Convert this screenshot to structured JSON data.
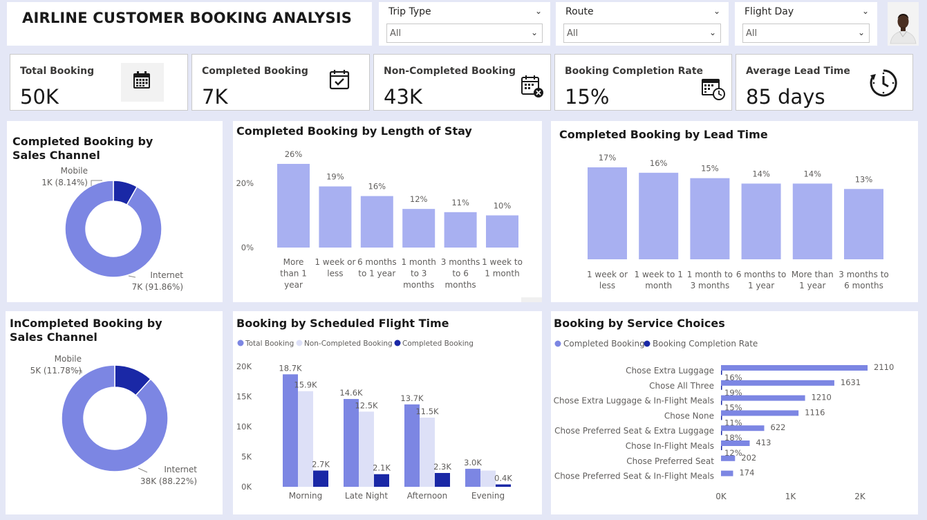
{
  "header": {
    "title": "AIRLINE CUSTOMER BOOKING ANALYSIS"
  },
  "slicers": [
    {
      "label": "Trip Type",
      "value": "All"
    },
    {
      "label": "Route",
      "value": "All"
    },
    {
      "label": "Flight Day",
      "value": "All"
    }
  ],
  "kpis": [
    {
      "label": "Total Booking",
      "value": "50K",
      "icon": "calendar-icon"
    },
    {
      "label": "Completed Booking",
      "value": "7K",
      "icon": "calendar-check-icon"
    },
    {
      "label": "Non-Completed Booking",
      "value": "43K",
      "icon": "calendar-x-icon"
    },
    {
      "label": "Booking Completion Rate",
      "value": "15%",
      "icon": "calendar-clock-icon"
    },
    {
      "label": "Average Lead Time",
      "value": "85 days",
      "icon": "timer-icon"
    }
  ],
  "colors": {
    "primary": "#7c86e3",
    "light": "#a8b0f1",
    "pale": "#dde0f7",
    "dark": "#1a28a6",
    "background": "#e4e7f6"
  },
  "chart_data": [
    {
      "id": "sales_channel_completed",
      "type": "pie",
      "title": "Completed Booking by Sales Channel",
      "slices": [
        {
          "name": "Mobile",
          "label": "1K (8.14%)",
          "value": 8.14
        },
        {
          "name": "Internet",
          "label": "7K (91.86%)",
          "value": 91.86
        }
      ]
    },
    {
      "id": "length_of_stay",
      "type": "bar",
      "title": "Completed Booking by Length of Stay",
      "categories": [
        [
          "More",
          "than 1",
          "year"
        ],
        [
          "1 week or",
          "less"
        ],
        [
          "6 months",
          "to 1 year"
        ],
        [
          "1 month",
          "to 3",
          "months"
        ],
        [
          "3 months",
          "to 6",
          "months"
        ],
        [
          "1 week to",
          "1 month"
        ]
      ],
      "values": [
        26,
        19,
        16,
        12,
        11,
        10
      ],
      "value_labels": [
        "26%",
        "19%",
        "16%",
        "12%",
        "11%",
        "10%"
      ],
      "yticks": [
        "0%",
        "20%"
      ],
      "ylim": [
        0,
        26
      ]
    },
    {
      "id": "lead_time",
      "type": "bar",
      "title": "Completed Booking by Lead Time",
      "categories": [
        [
          "1 week or",
          "less"
        ],
        [
          "1 week to 1",
          "month"
        ],
        [
          "1 month to",
          "3 months"
        ],
        [
          "6 months to",
          "1 year"
        ],
        [
          "More than",
          "1 year"
        ],
        [
          "3 months to",
          "6 months"
        ]
      ],
      "values": [
        17,
        16,
        15,
        14,
        14,
        13
      ],
      "value_labels": [
        "17%",
        "16%",
        "15%",
        "14%",
        "14%",
        "13%"
      ],
      "ylim": [
        0,
        17
      ]
    },
    {
      "id": "sales_channel_incompleted",
      "type": "pie",
      "title": "InCompleted Booking by Sales Channel",
      "slices": [
        {
          "name": "Mobile",
          "label": "5K (11.78%)",
          "value": 11.78
        },
        {
          "name": "Internet",
          "label": "38K (88.22%)",
          "value": 88.22
        }
      ]
    },
    {
      "id": "flight_time",
      "type": "bar",
      "title": "Booking by Scheduled Flight Time",
      "categories": [
        "Morning",
        "Late Night",
        "Afternoon",
        "Evening"
      ],
      "series": [
        {
          "name": "Total Booking",
          "values": [
            18.7,
            14.6,
            13.7,
            3.0
          ],
          "labels": [
            "18.7K",
            "14.6K",
            "13.7K",
            "3.0K"
          ]
        },
        {
          "name": "Non-Completed Booking",
          "values": [
            15.9,
            12.5,
            11.5,
            2.7
          ],
          "labels": [
            "15.9K",
            "12.5K",
            "11.5K",
            ""
          ]
        },
        {
          "name": "Completed Booking",
          "values": [
            2.7,
            2.1,
            2.3,
            0.4
          ],
          "labels": [
            "2.7K",
            "2.1K",
            "2.3K",
            "0.4K"
          ]
        }
      ],
      "yticks": [
        "0K",
        "5K",
        "10K",
        "15K",
        "20K"
      ],
      "ylim": [
        0,
        20
      ]
    },
    {
      "id": "service_choices",
      "type": "bar",
      "title": "Booking by Service Choices",
      "categories": [
        "Chose Extra Luggage",
        "Chose All Three",
        "Chose Extra Luggage & In-Flight Meals",
        "Chose None",
        "Chose Preferred Seat & Extra Luggage",
        "Chose In-Flight Meals",
        "Chose Preferred Seat",
        "Chose Preferred Seat & In-Flight Meals"
      ],
      "series": [
        {
          "name": "Completed Booking",
          "values": [
            2110,
            1631,
            1210,
            1116,
            622,
            413,
            202,
            174
          ],
          "labels": [
            "2110",
            "1631",
            "1210",
            "1116",
            "622",
            "413",
            "202",
            "174"
          ]
        },
        {
          "name": "Booking Completion Rate",
          "values": [
            16,
            19,
            15,
            11,
            18,
            12,
            null,
            null
          ],
          "labels": [
            "16%",
            "19%",
            "15%",
            "11%",
            "18%",
            "12%",
            "",
            ""
          ]
        }
      ],
      "xticks": [
        "0K",
        "1K",
        "2K"
      ],
      "xlim": [
        0,
        2000
      ]
    }
  ]
}
